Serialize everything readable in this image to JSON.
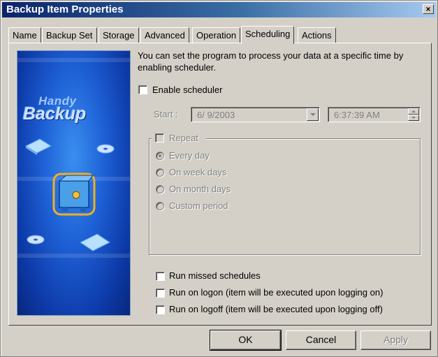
{
  "window": {
    "title": "Backup Item Properties",
    "close_glyph": "×"
  },
  "tabs": [
    {
      "label": "Name"
    },
    {
      "label": "Backup Set"
    },
    {
      "label": "Storage"
    },
    {
      "label": "Advanced"
    },
    {
      "label": "Operation"
    },
    {
      "label": "Scheduling",
      "active": true
    },
    {
      "label": "Actions"
    }
  ],
  "branding": {
    "line1": "Handy",
    "line2": "Backup"
  },
  "scheduling": {
    "description": "You can set the program to process your data at a specific time by enabling scheduler.",
    "enable_label": "Enable scheduler",
    "enable_checked": false,
    "start_label": "Start :",
    "start_date": "6/  9/2003",
    "start_time": "6:37:39 AM",
    "repeat_label": "Repeat",
    "repeat_options": [
      {
        "label": "Every day",
        "selected": true
      },
      {
        "label": "On week days",
        "selected": false
      },
      {
        "label": "On month days",
        "selected": false
      },
      {
        "label": "Custom period",
        "selected": false
      }
    ],
    "options": [
      {
        "label": "Run missed schedules",
        "checked": false
      },
      {
        "label": "Run on logon (item will be executed upon logging on)",
        "checked": false
      },
      {
        "label": "Run on logoff (item will be executed upon logging off)",
        "checked": false
      }
    ]
  },
  "buttons": {
    "ok": "OK",
    "cancel": "Cancel",
    "apply": "Apply"
  },
  "icons": [
    "close-icon",
    "dropdown-arrow-icon",
    "spin-up-icon",
    "spin-down-icon",
    "folder-icon",
    "cd-icon",
    "safe-icon"
  ],
  "colors": {
    "title_start": "#0a246a",
    "title_end": "#a6caf0",
    "face": "#d4d0c8",
    "art_blue": "#1d5fd4"
  }
}
